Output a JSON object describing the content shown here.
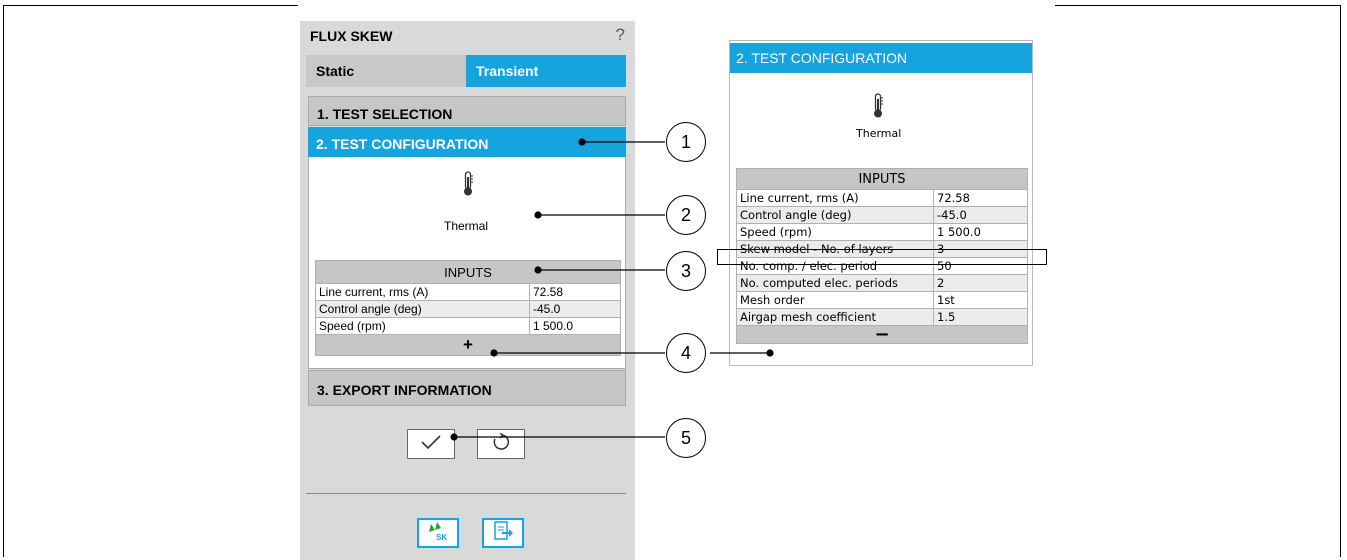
{
  "panel": {
    "title": "FLUX SKEW",
    "help": "?",
    "tabs": [
      "Static",
      "Transient"
    ],
    "sections": [
      "1. TEST SELECTION",
      "2. TEST CONFIGURATION",
      "3. EXPORT INFORMATION"
    ],
    "mode_label": "Thermal",
    "inputs_header": "INPUTS",
    "expand_symbol": "+",
    "rows": [
      {
        "label": "Line current, rms (A)",
        "value": "72.58"
      },
      {
        "label": "Control angle (deg)",
        "value": "-45.0"
      },
      {
        "label": "Speed (rpm)",
        "value": "1 500.0"
      }
    ],
    "buttons": {
      "confirm": "✓",
      "reset": "↺"
    },
    "bottom_buttons": {
      "sk_label": "SK"
    }
  },
  "expanded": {
    "header": "2. TEST CONFIGURATION",
    "mode_label": "Thermal",
    "inputs_header": "INPUTS",
    "collapse_symbol": "−",
    "rows": [
      {
        "label": "Line current, rms (A)",
        "value": "72.58"
      },
      {
        "label": "Control angle (deg)",
        "value": "-45.0"
      },
      {
        "label": "Speed (rpm)",
        "value": "1 500.0"
      },
      {
        "label": "Skew model - No. of layers",
        "value": "3"
      },
      {
        "label": "No. comp. / elec. period",
        "value": "50"
      },
      {
        "label": "No. computed elec. periods",
        "value": "2"
      },
      {
        "label": "Mesh order",
        "value": "1st"
      },
      {
        "label": "Airgap mesh coefficient",
        "value": "1.5"
      }
    ]
  },
  "callouts": [
    "1",
    "2",
    "3",
    "4",
    "5"
  ],
  "colors": {
    "accent": "#16a4de",
    "panel_bg": "#d9d9d9",
    "section_bg": "#c6c6c6"
  },
  "icons": [
    "thermometer-icon",
    "help-icon",
    "check-icon",
    "reset-icon",
    "flux-skew-icon",
    "export-icon"
  ]
}
